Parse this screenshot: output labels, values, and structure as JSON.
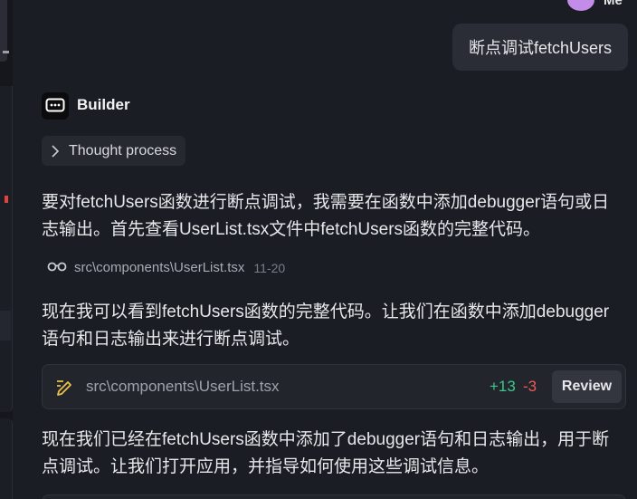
{
  "user": {
    "name": "Me"
  },
  "messages": {
    "user_message": "断点调试fetchUsers",
    "assistant_name": "Builder",
    "thought_label": "Thought process",
    "para1": "要对fetchUsers函数进行断点调试，我需要在函数中添加debugger语句或日志输出。首先查看UserList.tsx文件中fetchUsers函数的完整代码。",
    "file_ref": {
      "path": "src\\components\\UserList.tsx",
      "lines": "11-20"
    },
    "para2": "现在我可以看到fetchUsers函数的完整代码。让我们在函数中添加debugger语句和日志输出来进行断点调试。",
    "edit": {
      "path": "src\\components\\UserList.tsx",
      "added": "+13",
      "removed": "-3",
      "review_label": "Review"
    },
    "para3": "现在我们已经在fetchUsers函数中添加了debugger语句和日志输出，用于断点调试。让我们打开应用，并指导如何使用这些调试信息。"
  },
  "colors": {
    "background": "#1b1d24",
    "bubble": "#2a2d35",
    "added": "#3cc78a",
    "removed": "#ee5a5a",
    "avatar": "#c38ce8"
  },
  "icons": [
    "chevron-right-icon",
    "glasses-icon",
    "pencil-edit-icon",
    "builder-logo-icon"
  ]
}
